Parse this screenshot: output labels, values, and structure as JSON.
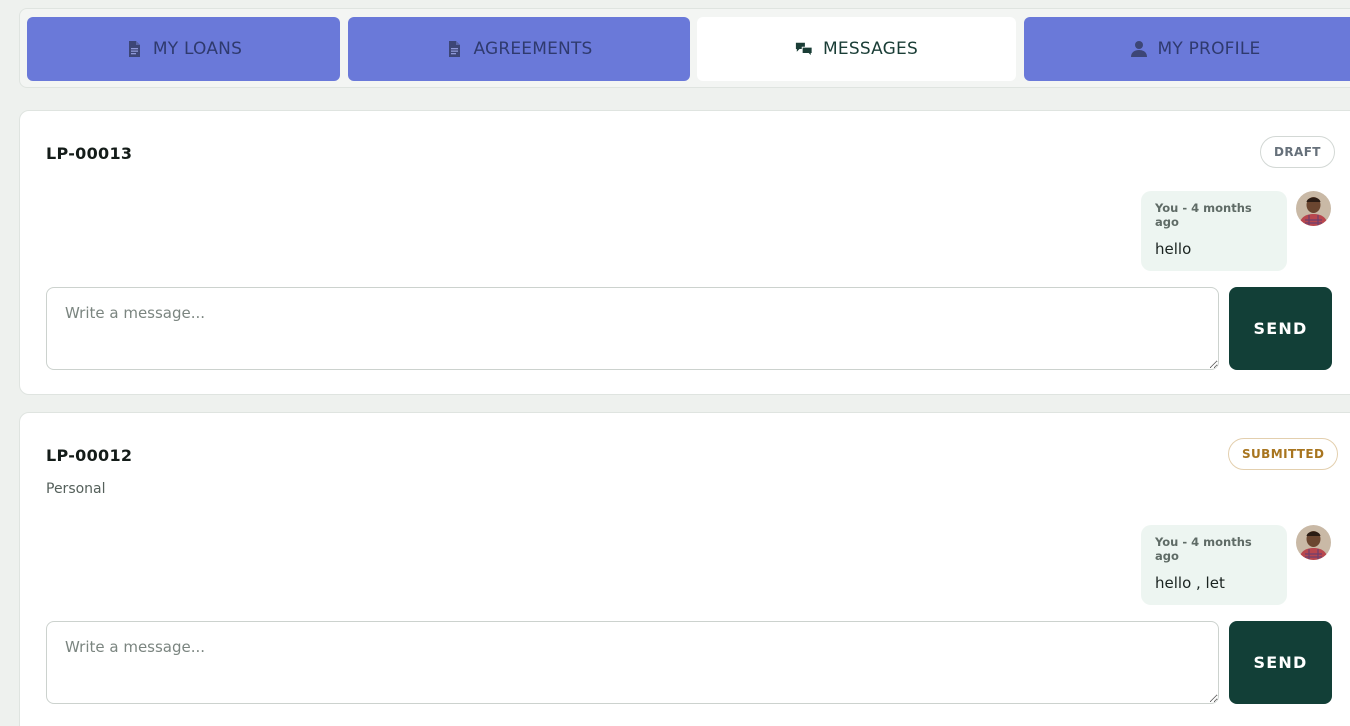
{
  "tabs": [
    {
      "label": "MY LOANS",
      "icon": "document-icon",
      "active": false
    },
    {
      "label": "AGREEMENTS",
      "icon": "document-icon",
      "active": false
    },
    {
      "label": "MESSAGES",
      "icon": "chat-bubbles-icon",
      "active": true
    },
    {
      "label": "MY PROFILE",
      "icon": "user-icon",
      "active": false
    }
  ],
  "colors": {
    "tab_inactive": "#6a79d9",
    "tab_active": "#ffffff",
    "send_button": "#123f37",
    "bubble_bg": "#edf5f1",
    "badge_draft": "#66707a",
    "badge_submitted": "#a8751f"
  },
  "threads": [
    {
      "loan_id": "LP-00013",
      "loan_type": "",
      "status": "DRAFT",
      "messages": [
        {
          "author_meta": "You - 4 months ago",
          "text": "hello"
        }
      ],
      "input_placeholder": "Write a message...",
      "send_label": "SEND"
    },
    {
      "loan_id": "LP-00012",
      "loan_type": "Personal",
      "status": "SUBMITTED",
      "messages": [
        {
          "author_meta": "You - 4 months ago",
          "text": "hello , let"
        }
      ],
      "input_placeholder": "Write a message...",
      "send_label": "SEND"
    }
  ]
}
